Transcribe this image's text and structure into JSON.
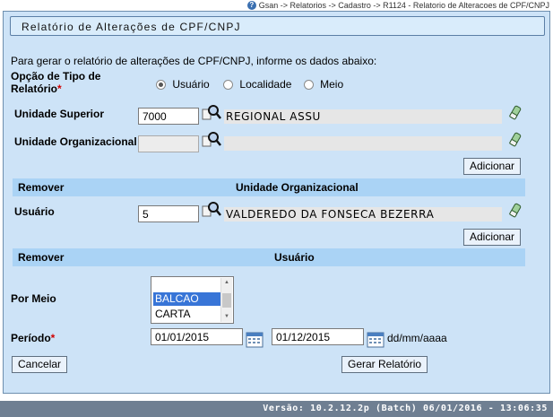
{
  "breadcrumb": "Gsan -> Relatorios -> Cadastro -> R1124 - Relatorio de Alteracoes de CPF/CNPJ",
  "title": "Relatório de Alterações de CPF/CNPJ",
  "intro": "Para gerar o relatório de alterações de CPF/CNPJ, informe os dados abaixo:",
  "report_type": {
    "label_line1": "Opção de Tipo de",
    "label_line2": "Relatório",
    "required_mark": "*",
    "options": [
      "Usuário",
      "Localidade",
      "Meio"
    ],
    "selected": "Usuário"
  },
  "unidade_superior": {
    "label": "Unidade Superior",
    "code": "7000",
    "name": "REGIONAL  ASSU"
  },
  "unidade_organizacional": {
    "label": "Unidade Organizacional",
    "code": "",
    "name": ""
  },
  "add_button_1": "Adicionar",
  "table_uo": {
    "col_remove": "Remover",
    "col_name": "Unidade Organizacional"
  },
  "usuario": {
    "label": "Usuário",
    "code": "5",
    "name": "VALDEREDO DA FONSECA BEZERRA"
  },
  "add_button_2": "Adicionar",
  "table_user": {
    "col_remove": "Remover",
    "col_name": "Usuário"
  },
  "por_meio": {
    "label": "Por Meio",
    "options": [
      "",
      "BALCAO",
      "CARTA"
    ],
    "selected": "BALCAO"
  },
  "periodo": {
    "label": "Período",
    "required_mark": "*",
    "start": "01/01/2015",
    "end": "01/12/2015",
    "format_hint": "dd/mm/aaaa"
  },
  "cancel_button": "Cancelar",
  "generate_button": "Gerar Relatório",
  "footer": "Versão: 10.2.12.2p (Batch) 06/01/2016 - 13:06:35",
  "colors": {
    "panel_bg": "#cde3f7",
    "header_bg": "#aad3f5",
    "required": "#d00000",
    "footer_bg": "#6f7f92",
    "selected_option": "#3875d7"
  }
}
